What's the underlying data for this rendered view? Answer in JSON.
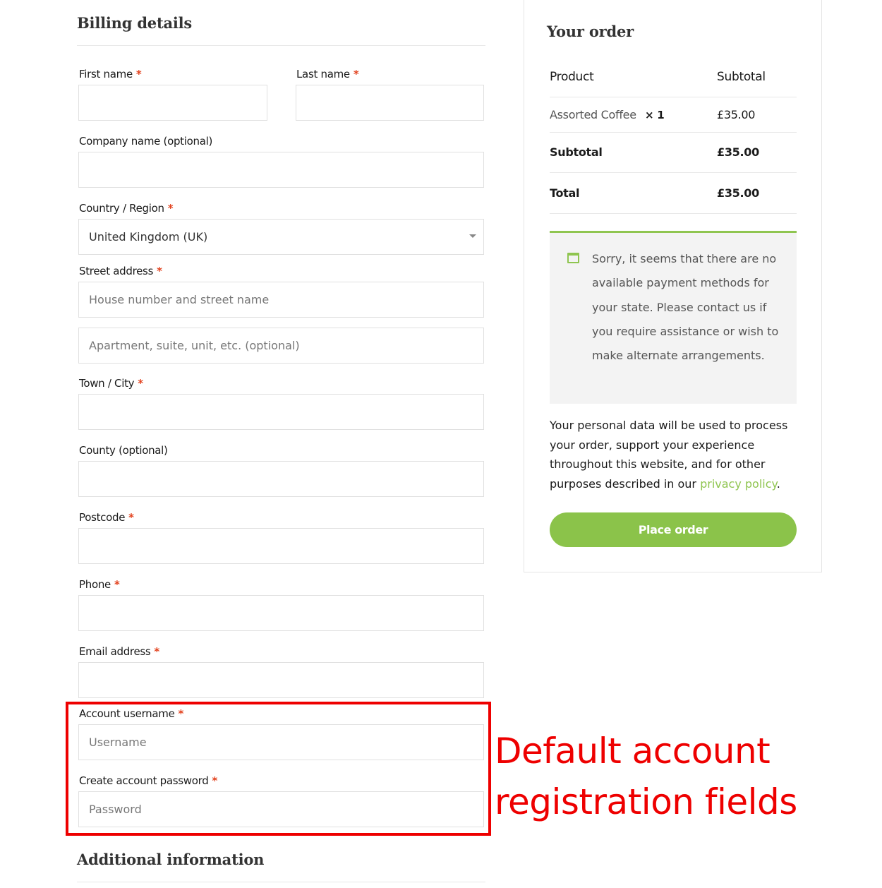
{
  "billing": {
    "title": "Billing details",
    "first_name_label": "First name",
    "last_name_label": "Last name",
    "company_label": "Company name (optional)",
    "country_label": "Country / Region",
    "country_value": "United Kingdom (UK)",
    "street_label": "Street address",
    "street_placeholder": "House number and street name",
    "street2_placeholder": "Apartment, suite, unit, etc. (optional)",
    "town_label": "Town / City",
    "county_label": "County (optional)",
    "postcode_label": "Postcode",
    "phone_label": "Phone",
    "email_label": "Email address",
    "username_label": "Account username",
    "username_placeholder": "Username",
    "password_label": "Create account password",
    "password_placeholder": "Password",
    "required_mark": "*"
  },
  "order": {
    "title": "Your order",
    "col_product": "Product",
    "col_subtotal": "Subtotal",
    "item_name": "Assorted Coffee",
    "item_qty": "× 1",
    "item_price": "£35.00",
    "subtotal_label": "Subtotal",
    "subtotal_value": "£35.00",
    "total_label": "Total",
    "total_value": "£35.00",
    "notice": "Sorry, it seems that there are no available payment methods for your state. Please contact us if you require assistance or wish to make alternate arrangements.",
    "privacy_text": "Your personal data will be used to process your order, support your experience throughout this website, and for other purposes described in our",
    "privacy_link": "privacy policy",
    "privacy_end": ".",
    "place_order_label": "Place order"
  },
  "annotation": {
    "text": "Default account registration fields",
    "color": "#ee0000"
  },
  "additional": {
    "title": "Additional information"
  },
  "colors": {
    "accent": "#8bc34a",
    "required": "#e2401c"
  }
}
